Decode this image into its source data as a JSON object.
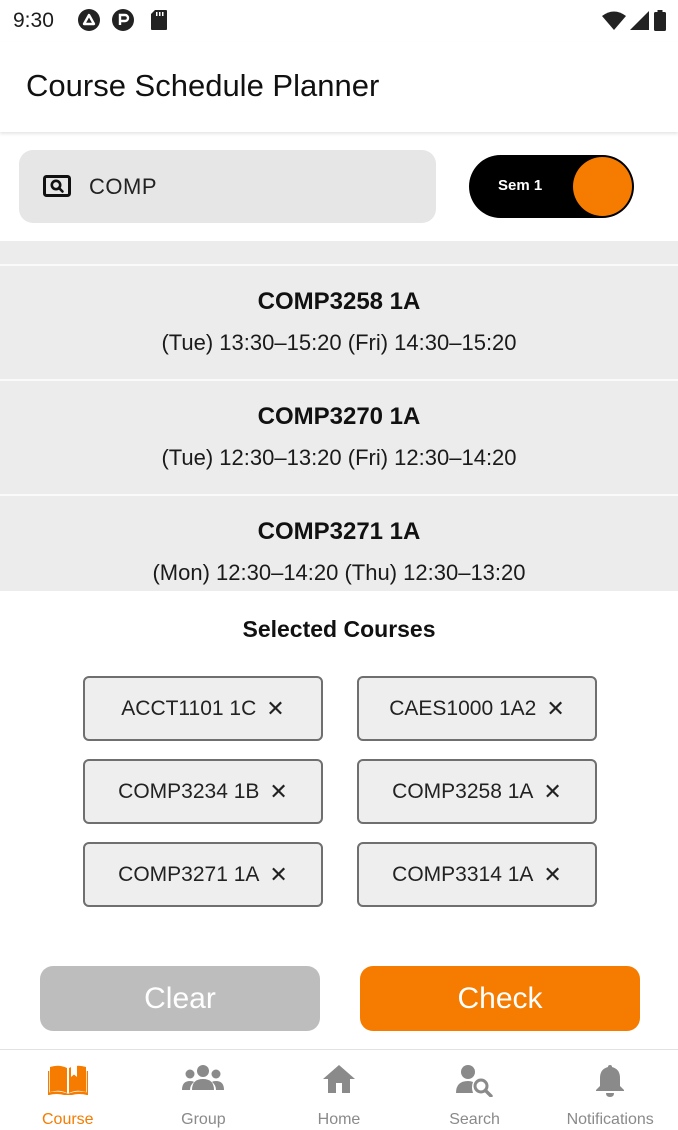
{
  "status_bar": {
    "time": "9:30"
  },
  "app_bar": {
    "title": "Course Schedule Planner"
  },
  "search": {
    "value": "COMP",
    "icon": "search-icon"
  },
  "semester_toggle": {
    "label": "Sem 1",
    "accent": "#f57c00"
  },
  "courses": [
    {
      "code": "COMP3258 1A",
      "time": "(Tue) 13:30–15:20   (Fri) 14:30–15:20"
    },
    {
      "code": "COMP3270 1A",
      "time": "(Tue) 12:30–13:20   (Fri) 12:30–14:20"
    },
    {
      "code": "COMP3271 1A",
      "time": "(Mon) 12:30–14:20   (Thu) 12:30–13:20"
    }
  ],
  "selected": {
    "title": "Selected Courses",
    "items": [
      {
        "label": "ACCT1101 1C",
        "remove": "✕"
      },
      {
        "label": "CAES1000 1A2",
        "remove": "✕"
      },
      {
        "label": "COMP3234 1B",
        "remove": "✕"
      },
      {
        "label": "COMP3258 1A",
        "remove": "✕"
      },
      {
        "label": "COMP3271 1A",
        "remove": "✕"
      },
      {
        "label": "COMP3314 1A",
        "remove": "✕"
      }
    ]
  },
  "actions": {
    "clear_label": "Clear",
    "check_label": "Check"
  },
  "bottom_nav": {
    "items": [
      {
        "label": "Course",
        "icon": "book-icon",
        "active": true
      },
      {
        "label": "Group",
        "icon": "people-icon",
        "active": false
      },
      {
        "label": "Home",
        "icon": "home-icon",
        "active": false
      },
      {
        "label": "Search",
        "icon": "person-search-icon",
        "active": false
      },
      {
        "label": "Notifications",
        "icon": "bell-icon",
        "active": false
      }
    ]
  },
  "colors": {
    "accent": "#f57c00",
    "disabled_button": "#bdbdbd",
    "list_bg": "#ececec"
  }
}
